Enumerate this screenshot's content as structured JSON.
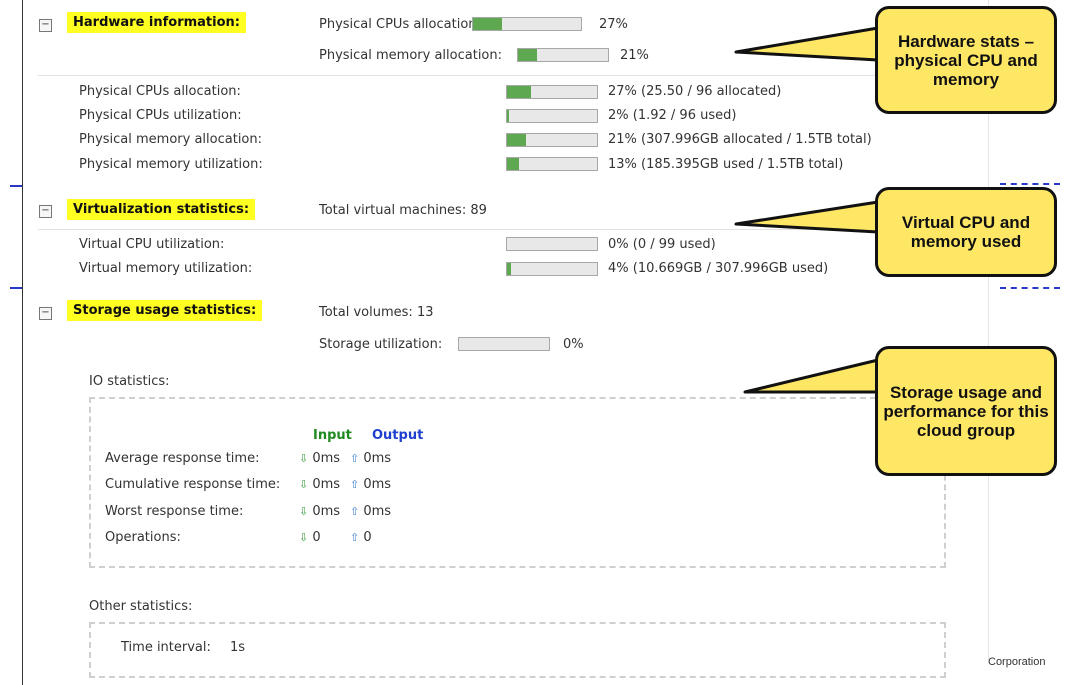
{
  "hardware": {
    "title": "Hardware information:",
    "summary": [
      {
        "label": "Physical CPUs allocation:",
        "percent": 27,
        "value": "27%"
      },
      {
        "label": "Physical memory allocation:",
        "percent": 21,
        "value": "21%"
      }
    ],
    "details": [
      {
        "label": "Physical CPUs allocation:",
        "percent": 27,
        "value": "27% (25.50 / 96 allocated)"
      },
      {
        "label": "Physical CPUs utilization:",
        "percent": 2,
        "value": "2% (1.92 / 96 used)"
      },
      {
        "label": "Physical memory allocation:",
        "percent": 21,
        "value": "21% (307.996GB allocated / 1.5TB total)"
      },
      {
        "label": "Physical memory utilization:",
        "percent": 13,
        "value": "13% (185.395GB used / 1.5TB total)"
      }
    ]
  },
  "virtualization": {
    "title": "Virtualization statistics:",
    "total": "Total virtual machines: 89",
    "details": [
      {
        "label": "Virtual CPU utilization:",
        "percent": 0,
        "value": "0% (0 / 99 used)"
      },
      {
        "label": "Virtual memory utilization:",
        "percent": 4,
        "value": "4% (10.669GB / 307.996GB used)"
      }
    ]
  },
  "storage": {
    "title": "Storage usage statistics:",
    "total": "Total volumes: 13",
    "utilization_label": "Storage utilization:",
    "utilization_percent": 0,
    "utilization_value": "0%",
    "io": {
      "title": "IO statistics:",
      "input_header": "Input",
      "output_header": "Output",
      "rows": [
        {
          "label": "Average response time:",
          "input": "0ms",
          "output": "0ms"
        },
        {
          "label": "Cumulative response time:",
          "input": "0ms",
          "output": "0ms"
        },
        {
          "label": "Worst response time:",
          "input": "0ms",
          "output": "0ms"
        },
        {
          "label": "Operations:",
          "input": "0",
          "output": "0"
        }
      ]
    },
    "other": {
      "title": "Other statistics:",
      "time_interval_label": "Time interval:",
      "time_interval_value": "1s"
    }
  },
  "callouts": {
    "hardware": "Hardware stats – physical CPU and memory",
    "virtual": "Virtual CPU and memory used",
    "storage": "Storage usage and performance for this cloud group"
  },
  "footer": {
    "corp": "Corporation"
  },
  "icons": {
    "collapse": "minus-icon",
    "input_arrow": "arrow-down-icon",
    "output_arrow": "arrow-up-icon"
  },
  "colors": {
    "highlight": "#ffff22",
    "bar_fill": "#5fa852",
    "callout": "#ffe766",
    "input": "#1f8a1f",
    "output": "#1f3fcf"
  }
}
